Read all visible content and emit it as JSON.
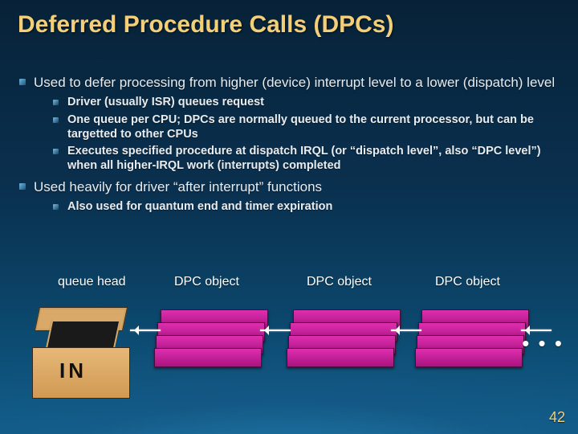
{
  "title": "Deferred Procedure Calls (DPCs)",
  "bullets": [
    {
      "text": "Used to defer processing from higher (device) interrupt level to a lower (dispatch) level",
      "sub": [
        "Driver (usually ISR) queues request",
        "One queue per CPU;  DPCs are normally queued to the current processor, but can be targetted to other CPUs",
        "Executes specified procedure at dispatch IRQL (or “dispatch level”, also “DPC level”) when all higher-IRQL work (interrupts) completed"
      ]
    },
    {
      "text": "Used heavily for driver “after interrupt” functions",
      "sub": [
        "Also used for quantum end and timer expiration"
      ]
    }
  ],
  "diagram": {
    "queue_head_label": "queue head",
    "dpc_label_1": "DPC object",
    "dpc_label_2": "DPC object",
    "dpc_label_3": "DPC object",
    "in_label": "IN",
    "ellipsis": "• • •"
  },
  "page_number": "42"
}
